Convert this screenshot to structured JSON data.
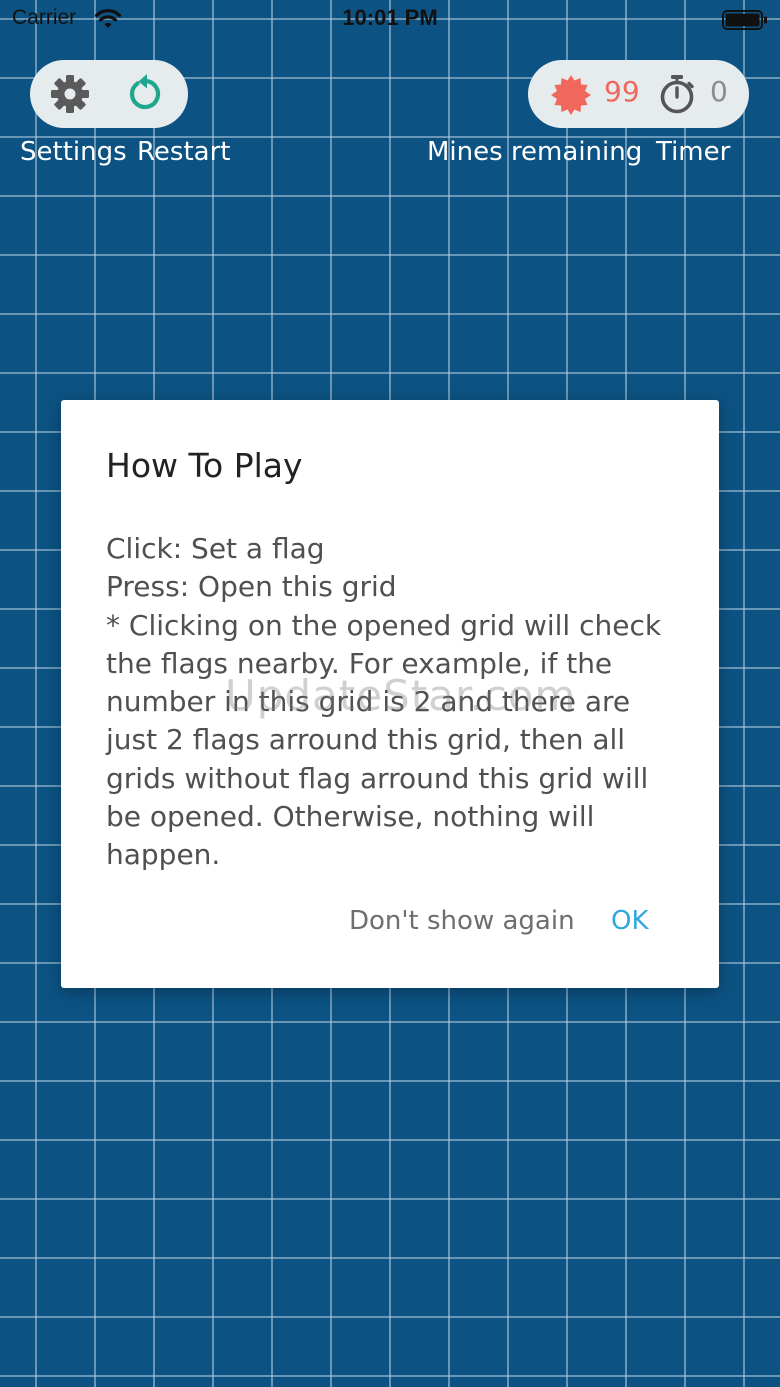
{
  "status_bar": {
    "carrier": "Carrier",
    "time": "10:01 PM"
  },
  "controls": {
    "settings_icon": "gear-icon",
    "restart_icon": "restart-icon",
    "mine_icon": "mine-icon",
    "mines_remaining": "99",
    "timer_icon": "stopwatch-icon",
    "timer_value": "0",
    "labels": {
      "settings": "Settings",
      "restart": "Restart",
      "mines_remaining": "Mines remaining",
      "timer": "Timer"
    }
  },
  "dialog": {
    "title": "How To Play",
    "lines": [
      "Click: Set a flag",
      "Press: Open this grid",
      "* Clicking on the opened grid will check the flags nearby. For example, if the number in this grid is 2 and there are just 2 flags arround this grid, then all grids without flag arround this grid will be opened. Otherwise, nothing will happen."
    ],
    "dont_show_label": "Don't show again",
    "ok_label": "OK"
  },
  "watermark": "UpdateStar.com",
  "colors": {
    "background": "#0c5383",
    "mine": "#f0675c",
    "restart": "#1fa78e",
    "ok": "#2fa9dc"
  }
}
